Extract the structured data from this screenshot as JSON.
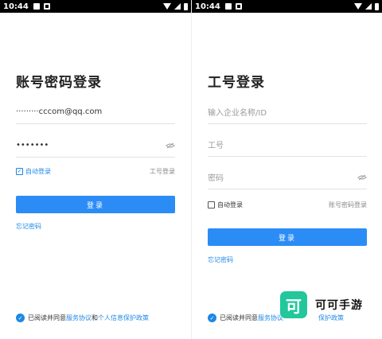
{
  "left": {
    "status": {
      "time": "10:44"
    },
    "title": "账号密码登录",
    "account_value": "·········cccom@qq.com",
    "password_value": "•••••••",
    "auto_login": "自动登录",
    "switch_link": "工号登录",
    "login_button": "登录",
    "forgot": "忘记密码",
    "agree_prefix": "已阅读并同意",
    "agree_service": "服务协议",
    "agree_and": "和",
    "agree_privacy": "个人信息保护政策"
  },
  "right": {
    "status": {
      "time": "10:44"
    },
    "title": "工号登录",
    "company_placeholder": "输入企业名称/ID",
    "id_placeholder": "工号",
    "password_placeholder": "密码",
    "auto_login": "自动登录",
    "switch_link": "账号密码登录",
    "login_button": "登录",
    "forgot": "忘记密码",
    "agree_prefix": "已阅读并同意",
    "agree_service": "服务协议",
    "agree_privacy": "保护政策"
  },
  "watermark": {
    "logo_char": "可",
    "text": "可可手游"
  },
  "colors": {
    "accent": "#2b8cf6",
    "link": "#1e88e5",
    "watermark_green": "#22c79b"
  }
}
